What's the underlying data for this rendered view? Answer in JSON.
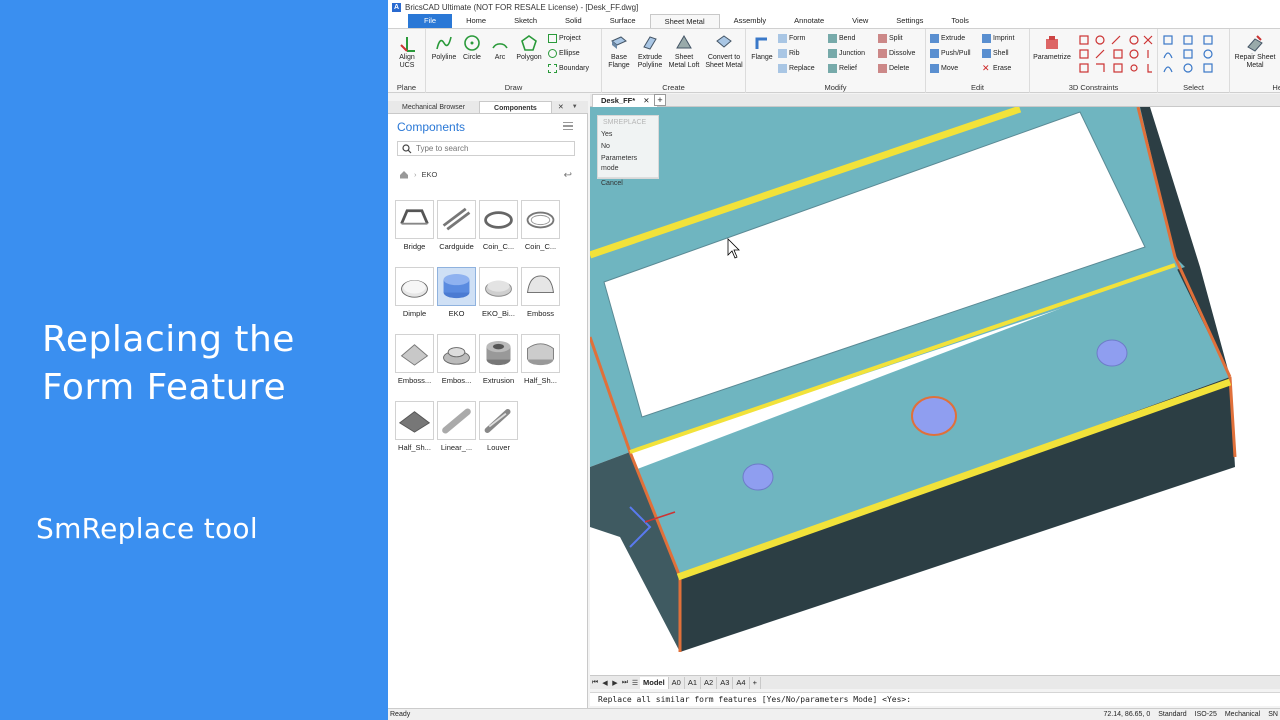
{
  "promo": {
    "title": "Replacing the Form Feature",
    "subtitle": "SmReplace tool"
  },
  "window": {
    "title": "BricsCAD Ultimate (NOT FOR RESALE License) - [Desk_FF.dwg]"
  },
  "menu": {
    "tabs": [
      "File",
      "Home",
      "Sketch",
      "Solid",
      "Surface",
      "Sheet Metal",
      "Assembly",
      "Annotate",
      "View",
      "Settings",
      "Tools"
    ],
    "active": "Sheet Metal"
  },
  "ribbon": {
    "groups": [
      "Plane",
      "Draw",
      "Create",
      "Modify",
      "Edit",
      "3D Constraints",
      "Select",
      "He"
    ],
    "plane": {
      "align_ucs": "Align UCS"
    },
    "draw": {
      "polyline": "Polyline",
      "circle": "Circle",
      "arc": "Arc",
      "polygon": "Polygon",
      "project": "Project",
      "ellipse": "Ellipse",
      "boundary": "Boundary"
    },
    "create": {
      "base_flange": "Base Flange",
      "extrude_polyline": "Extrude Polyline",
      "sheet_metal_loft": "Sheet Metal Loft",
      "convert": "Convert to Sheet Metal"
    },
    "modify": {
      "flange": "Flange",
      "form": "Form",
      "rib": "Rib",
      "replace": "Replace",
      "bend": "Bend",
      "junction": "Junction",
      "relief": "Relief",
      "split": "Split",
      "dissolve": "Dissolve",
      "delete": "Delete"
    },
    "edit": {
      "extrude": "Extrude",
      "push_pull": "Push/Pull",
      "move": "Move",
      "imprint": "Imprint",
      "shell": "Shell",
      "erase": "Erase"
    },
    "constraints": {
      "parametrize": "Parametrize"
    },
    "help": {
      "repair": "Repair Sheet Metal"
    }
  },
  "panel": {
    "tabs": [
      "Mechanical Browser",
      "Components"
    ],
    "active_tab": "Components",
    "title": "Components",
    "search_placeholder": "Type to search",
    "breadcrumb": "EKO",
    "items": [
      {
        "label": "Bridge",
        "shape": "bridge"
      },
      {
        "label": "Cardguide",
        "shape": "cardguide"
      },
      {
        "label": "Coin_C...",
        "shape": "coin"
      },
      {
        "label": "Coin_C...",
        "shape": "coin2"
      },
      {
        "label": "Dimple",
        "shape": "dimple"
      },
      {
        "label": "EKO",
        "shape": "eko",
        "selected": true
      },
      {
        "label": "EKO_Bi...",
        "shape": "ekobig"
      },
      {
        "label": "Emboss",
        "shape": "emboss"
      },
      {
        "label": "Emboss...",
        "shape": "emboss2"
      },
      {
        "label": "Embos...",
        "shape": "emboss3"
      },
      {
        "label": "Extrusion",
        "shape": "extrusion"
      },
      {
        "label": "Half_Sh...",
        "shape": "halfsh"
      },
      {
        "label": "Half_Sh...",
        "shape": "halfsh2"
      },
      {
        "label": "Linear_...",
        "shape": "linear"
      },
      {
        "label": "Louver",
        "shape": "louver"
      }
    ]
  },
  "document": {
    "tab": "Desk_FF*"
  },
  "context_menu": {
    "header": "SMREPLACE",
    "options": [
      "Yes",
      "No",
      "Parameters mode",
      "Cancel"
    ]
  },
  "layout_tabs": [
    "Model",
    "A0",
    "A1",
    "A2",
    "A3",
    "A4"
  ],
  "command_line": "Replace all similar form features [Yes/No/parameters Mode] <Yes>:",
  "status": {
    "left": "Ready",
    "coords": "72.14, 86.65, 0",
    "style": "Standard",
    "dimstyle": "ISO-25",
    "workspace": "Mechanical",
    "extra": "SN"
  },
  "colors": {
    "promo_bg": "#3a8ff0",
    "accent": "#2a78d6",
    "model_top": "#6fb5c0",
    "model_side": "#2c3e44",
    "edge_yellow": "#f2e23a",
    "edge_orange": "#e0703a",
    "form_features": "#8f9ef0"
  }
}
